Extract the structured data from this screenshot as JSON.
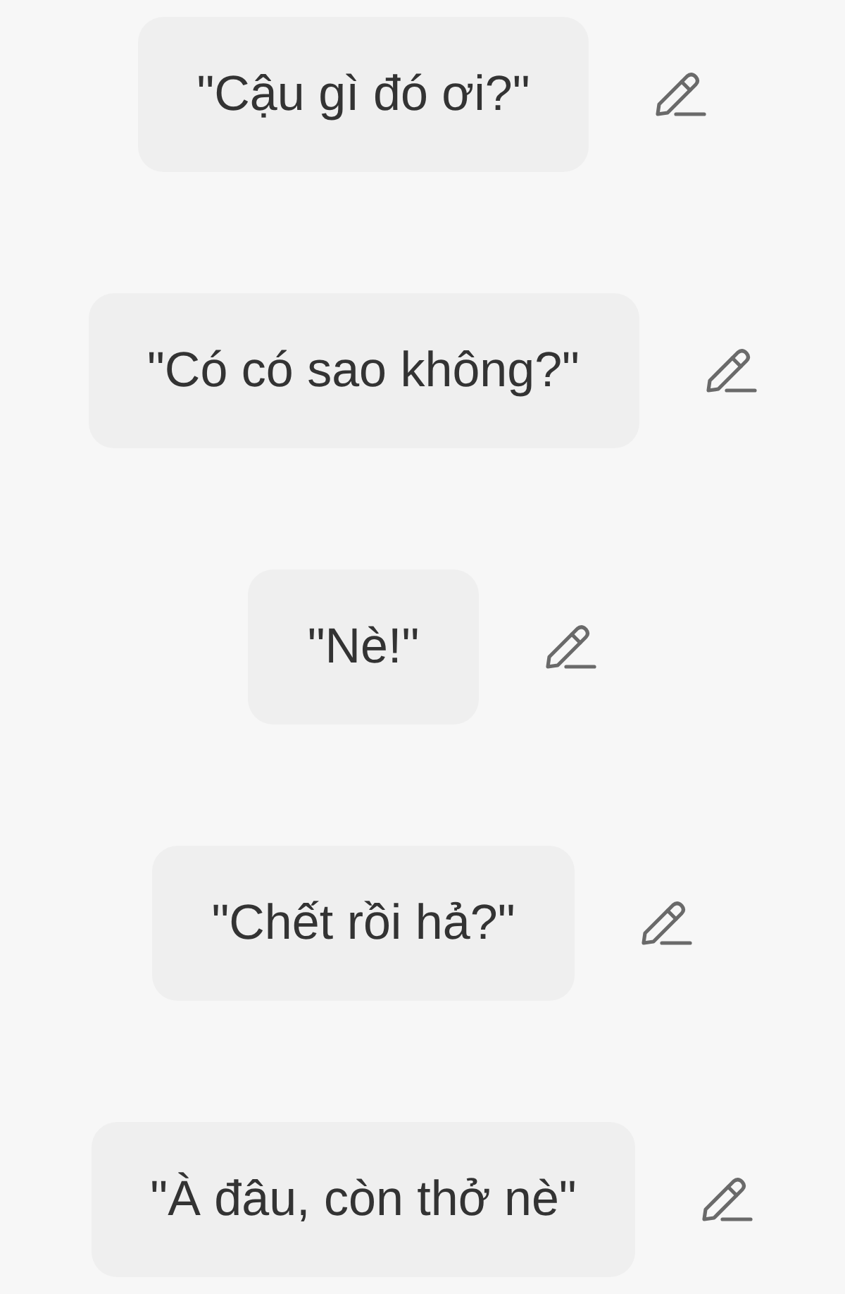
{
  "messages": [
    {
      "text": "\"Cậu gì đó ơi?\""
    },
    {
      "text": "\"Có có sao không?\""
    },
    {
      "text": "\"Nè!\""
    },
    {
      "text": "\"Chết rồi hả?\""
    },
    {
      "text": "\"À đâu, còn thở nè\""
    }
  ]
}
